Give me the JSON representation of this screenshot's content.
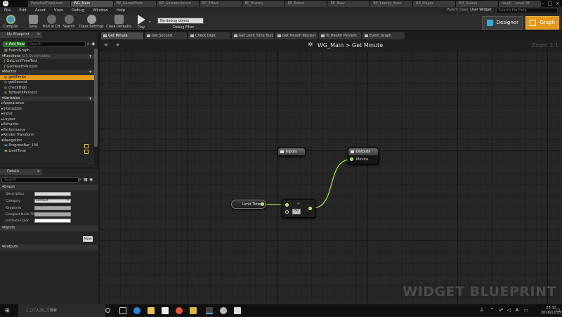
{
  "editor_tabs": [
    "ParadiseFlowLevel",
    "WG_Main",
    "BP_GameMode",
    "BP_GameInstance",
    "BP_Effect",
    "BP_Enemy",
    "BP_Robot",
    "BP_Bear",
    "BP_Enemy_Boss",
    "BP_Player",
    "EM_Status",
    "result - Level BP"
  ],
  "menu": [
    "File",
    "Edit",
    "Asset",
    "View",
    "Debug",
    "Window",
    "Help"
  ],
  "parent_class_label": "Parent class:",
  "parent_class_value": "User Widget",
  "search_help_placeholder": "Search For Help",
  "toolbar": {
    "compile": "Compile",
    "save": "Save",
    "find_cb": "Find in CB",
    "search": "Search",
    "class_settings": "Class Settings",
    "class_defaults": "Class Defaults",
    "play": "Play",
    "debug_select": "No debug object selected",
    "debug_filter": "Debug Filter",
    "designer": "Designer",
    "graph": "Graph"
  },
  "my_blueprint": {
    "tab": "My Blueprint",
    "add_new": "+ Add New",
    "search_placeholder": "Search",
    "event_graph": "EventGraph",
    "functions_header": "Functions",
    "functions_sub": "(23 Overridable)",
    "functions": [
      "GetLimitTimeText",
      "GetHealthPercent"
    ],
    "macros_header": "Macros",
    "macros": [
      "getMinute",
      "getSecond",
      "checkDigit",
      "ToHealthPercent"
    ],
    "variables_header": "Variables",
    "categories": [
      "Appearance",
      "Interaction",
      "Input",
      "Layout",
      "Behavior",
      "Performance",
      "Render Transform",
      "Navigation"
    ],
    "variables": [
      "ProgressBar_136",
      "LimitTime"
    ]
  },
  "details": {
    "tab": "Details",
    "search_placeholder": "Search",
    "graph_section": "Graph",
    "fields": [
      "Description",
      "Category",
      "Keywords",
      "Compact Node Title",
      "Instance Color"
    ],
    "category_value": "Default",
    "inputs_section": "Inputs",
    "new_button": "New",
    "outputs_section": "Outputs"
  },
  "doc_tabs": [
    "Get Minute",
    "Get Second",
    "Check Digit",
    "Get Limit Time Text",
    "Get Health Percent",
    "To Health Percent",
    "Event Graph"
  ],
  "graph": {
    "breadcrumb_root": "WG_Main",
    "breadcrumb_sep": ">",
    "breadcrumb_leaf": "Get Minute",
    "zoom": "Zoom 1:1",
    "watermark": "WIDGET BLUEPRINT",
    "nodes": {
      "inputs_title": "Inputs",
      "outputs_title": "Outputs",
      "outputs_pin": "Minute",
      "limit_time": "Limit Time",
      "divide_op": "÷",
      "divide_value": "60"
    }
  },
  "taskbar": {
    "search_placeholder": "ここに入力して検索",
    "time": "23:32",
    "date": "2016/12/23"
  }
}
